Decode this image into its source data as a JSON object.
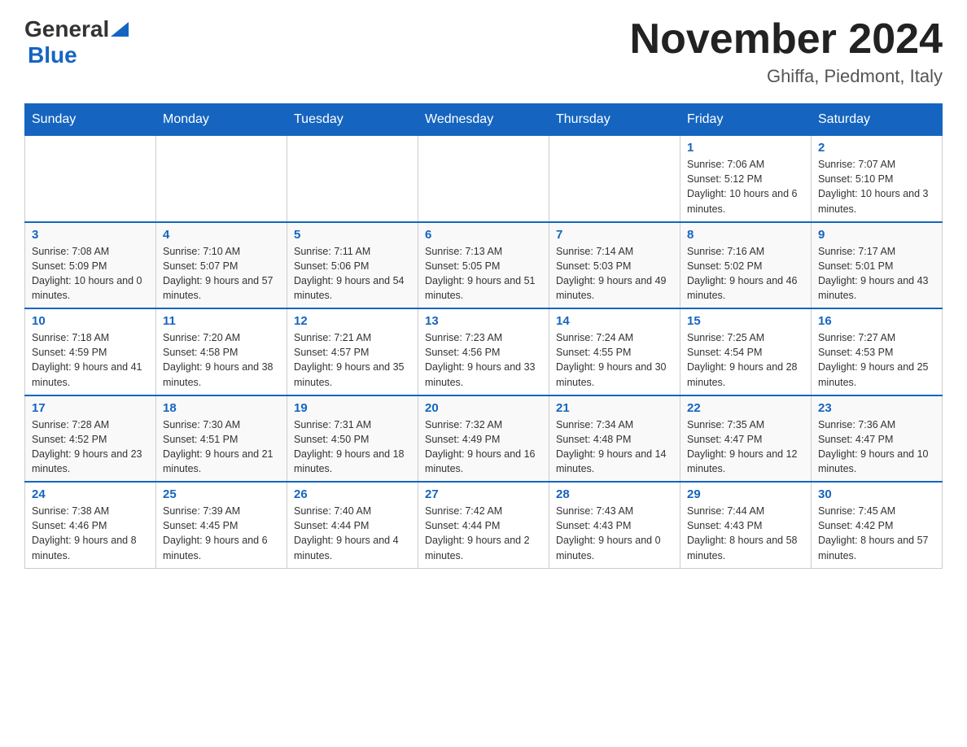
{
  "header": {
    "logo_line1": "General",
    "logo_line2": "Blue",
    "month": "November 2024",
    "location": "Ghiffa, Piedmont, Italy"
  },
  "weekdays": [
    "Sunday",
    "Monday",
    "Tuesday",
    "Wednesday",
    "Thursday",
    "Friday",
    "Saturday"
  ],
  "weeks": [
    [
      {
        "day": "",
        "info": ""
      },
      {
        "day": "",
        "info": ""
      },
      {
        "day": "",
        "info": ""
      },
      {
        "day": "",
        "info": ""
      },
      {
        "day": "",
        "info": ""
      },
      {
        "day": "1",
        "info": "Sunrise: 7:06 AM\nSunset: 5:12 PM\nDaylight: 10 hours and 6 minutes."
      },
      {
        "day": "2",
        "info": "Sunrise: 7:07 AM\nSunset: 5:10 PM\nDaylight: 10 hours and 3 minutes."
      }
    ],
    [
      {
        "day": "3",
        "info": "Sunrise: 7:08 AM\nSunset: 5:09 PM\nDaylight: 10 hours and 0 minutes."
      },
      {
        "day": "4",
        "info": "Sunrise: 7:10 AM\nSunset: 5:07 PM\nDaylight: 9 hours and 57 minutes."
      },
      {
        "day": "5",
        "info": "Sunrise: 7:11 AM\nSunset: 5:06 PM\nDaylight: 9 hours and 54 minutes."
      },
      {
        "day": "6",
        "info": "Sunrise: 7:13 AM\nSunset: 5:05 PM\nDaylight: 9 hours and 51 minutes."
      },
      {
        "day": "7",
        "info": "Sunrise: 7:14 AM\nSunset: 5:03 PM\nDaylight: 9 hours and 49 minutes."
      },
      {
        "day": "8",
        "info": "Sunrise: 7:16 AM\nSunset: 5:02 PM\nDaylight: 9 hours and 46 minutes."
      },
      {
        "day": "9",
        "info": "Sunrise: 7:17 AM\nSunset: 5:01 PM\nDaylight: 9 hours and 43 minutes."
      }
    ],
    [
      {
        "day": "10",
        "info": "Sunrise: 7:18 AM\nSunset: 4:59 PM\nDaylight: 9 hours and 41 minutes."
      },
      {
        "day": "11",
        "info": "Sunrise: 7:20 AM\nSunset: 4:58 PM\nDaylight: 9 hours and 38 minutes."
      },
      {
        "day": "12",
        "info": "Sunrise: 7:21 AM\nSunset: 4:57 PM\nDaylight: 9 hours and 35 minutes."
      },
      {
        "day": "13",
        "info": "Sunrise: 7:23 AM\nSunset: 4:56 PM\nDaylight: 9 hours and 33 minutes."
      },
      {
        "day": "14",
        "info": "Sunrise: 7:24 AM\nSunset: 4:55 PM\nDaylight: 9 hours and 30 minutes."
      },
      {
        "day": "15",
        "info": "Sunrise: 7:25 AM\nSunset: 4:54 PM\nDaylight: 9 hours and 28 minutes."
      },
      {
        "day": "16",
        "info": "Sunrise: 7:27 AM\nSunset: 4:53 PM\nDaylight: 9 hours and 25 minutes."
      }
    ],
    [
      {
        "day": "17",
        "info": "Sunrise: 7:28 AM\nSunset: 4:52 PM\nDaylight: 9 hours and 23 minutes."
      },
      {
        "day": "18",
        "info": "Sunrise: 7:30 AM\nSunset: 4:51 PM\nDaylight: 9 hours and 21 minutes."
      },
      {
        "day": "19",
        "info": "Sunrise: 7:31 AM\nSunset: 4:50 PM\nDaylight: 9 hours and 18 minutes."
      },
      {
        "day": "20",
        "info": "Sunrise: 7:32 AM\nSunset: 4:49 PM\nDaylight: 9 hours and 16 minutes."
      },
      {
        "day": "21",
        "info": "Sunrise: 7:34 AM\nSunset: 4:48 PM\nDaylight: 9 hours and 14 minutes."
      },
      {
        "day": "22",
        "info": "Sunrise: 7:35 AM\nSunset: 4:47 PM\nDaylight: 9 hours and 12 minutes."
      },
      {
        "day": "23",
        "info": "Sunrise: 7:36 AM\nSunset: 4:47 PM\nDaylight: 9 hours and 10 minutes."
      }
    ],
    [
      {
        "day": "24",
        "info": "Sunrise: 7:38 AM\nSunset: 4:46 PM\nDaylight: 9 hours and 8 minutes."
      },
      {
        "day": "25",
        "info": "Sunrise: 7:39 AM\nSunset: 4:45 PM\nDaylight: 9 hours and 6 minutes."
      },
      {
        "day": "26",
        "info": "Sunrise: 7:40 AM\nSunset: 4:44 PM\nDaylight: 9 hours and 4 minutes."
      },
      {
        "day": "27",
        "info": "Sunrise: 7:42 AM\nSunset: 4:44 PM\nDaylight: 9 hours and 2 minutes."
      },
      {
        "day": "28",
        "info": "Sunrise: 7:43 AM\nSunset: 4:43 PM\nDaylight: 9 hours and 0 minutes."
      },
      {
        "day": "29",
        "info": "Sunrise: 7:44 AM\nSunset: 4:43 PM\nDaylight: 8 hours and 58 minutes."
      },
      {
        "day": "30",
        "info": "Sunrise: 7:45 AM\nSunset: 4:42 PM\nDaylight: 8 hours and 57 minutes."
      }
    ]
  ]
}
